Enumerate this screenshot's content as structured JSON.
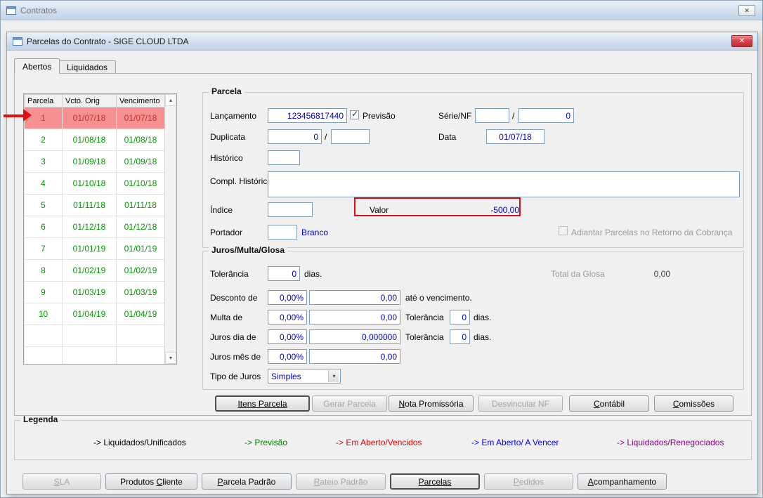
{
  "icons": {
    "close": "✕",
    "scroll_up": "▴",
    "scroll_down": "▾",
    "dropdown": "▾",
    "check": "✓"
  },
  "outer_window": {
    "title": "Contratos"
  },
  "dialog": {
    "title": "Parcelas do Contrato - SIGE CLOUD LTDA"
  },
  "tabs": {
    "abertos": "Abertos",
    "liquidados": "Liquidados"
  },
  "grid": {
    "headers": [
      "Parcela",
      "Vcto. Orig",
      "Vencimento"
    ],
    "rows": [
      {
        "parcela": "1",
        "vcto_orig": "01/07/18",
        "vencimento": "01/07/18",
        "state": "selected"
      },
      {
        "parcela": "2",
        "vcto_orig": "01/08/18",
        "vencimento": "01/08/18",
        "state": "previsao"
      },
      {
        "parcela": "3",
        "vcto_orig": "01/09/18",
        "vencimento": "01/09/18",
        "state": "previsao"
      },
      {
        "parcela": "4",
        "vcto_orig": "01/10/18",
        "vencimento": "01/10/18",
        "state": "previsao"
      },
      {
        "parcela": "5",
        "vcto_orig": "01/11/18",
        "vencimento": "01/11/18",
        "state": "previsao"
      },
      {
        "parcela": "6",
        "vcto_orig": "01/12/18",
        "vencimento": "01/12/18",
        "state": "previsao"
      },
      {
        "parcela": "7",
        "vcto_orig": "01/01/19",
        "vencimento": "01/01/19",
        "state": "previsao"
      },
      {
        "parcela": "8",
        "vcto_orig": "01/02/19",
        "vencimento": "01/02/19",
        "state": "previsao"
      },
      {
        "parcela": "9",
        "vcto_orig": "01/03/19",
        "vencimento": "01/03/19",
        "state": "previsao"
      },
      {
        "parcela": "10",
        "vcto_orig": "01/04/19",
        "vencimento": "01/04/19",
        "state": "previsao"
      }
    ],
    "empty_rows": 2
  },
  "parcela_box": {
    "title": "Parcela",
    "lancamento_label": "Lançamento",
    "lancamento_value": "123456817440",
    "previsao_label": "Previsão",
    "previsao_checked": true,
    "serie_nf_label": "Série/NF",
    "serie_value": "",
    "serie_sep": "/",
    "nf_value": "0",
    "duplicata_label": "Duplicata",
    "duplicata_value": "0",
    "duplicata_sep": "/",
    "duplicata_value2": "",
    "data_label": "Data",
    "data_value": "01/07/18",
    "historico_label": "Histórico",
    "historico_value": "",
    "compl_historico_label": "Compl. Histórico",
    "compl_historico_value": "",
    "indice_label": "Índice",
    "indice_value": "",
    "valor_label": "Valor",
    "valor_value": "-500,00",
    "portador_label": "Portador",
    "portador_value": "",
    "portador_desc": "Branco",
    "adiantar_label": "Adiantar Parcelas no Retorno da Cobrança"
  },
  "juros_box": {
    "title": "Juros/Multa/Glosa",
    "tolerancia_label": "Tolerância",
    "tolerancia_value": "0",
    "tolerancia_dias_label": "dias.",
    "total_glosa_label": "Total da Glosa",
    "total_glosa_value": "0,00",
    "desconto_label": "Desconto de",
    "desconto_pct": "0,00%",
    "desconto_value": "0,00",
    "ate_vencimento_label": "até o vencimento.",
    "multa_label": "Multa de",
    "multa_pct": "0,00%",
    "multa_value": "0,00",
    "multa_tolerancia_label": "Tolerância",
    "multa_tolerancia_value": "0",
    "multa_dias_label": "dias.",
    "juros_dia_label": "Juros dia de",
    "juros_dia_pct": "0,00%",
    "juros_dia_value": "0,000000",
    "juros_dia_tolerancia_label": "Tolerância",
    "juros_dia_tolerancia_value": "0",
    "juros_dia_dias_label": "dias.",
    "juros_mes_label": "Juros mês de",
    "juros_mes_pct": "0,00%",
    "juros_mes_value": "0,00",
    "tipo_juros_label": "Tipo de Juros",
    "tipo_juros_value": "Simples"
  },
  "action_buttons": [
    {
      "name": "itens-parcela-button",
      "label": "Itens Parcela",
      "ul": "Itens Parcela",
      "enabled": true,
      "default": true
    },
    {
      "name": "gerar-parcela-button",
      "label": "Gerar Parcela",
      "ul": "",
      "enabled": false,
      "default": false
    },
    {
      "name": "nota-promissoria-button",
      "label": "Nota Promissória",
      "ul": "N",
      "enabled": true,
      "default": false
    },
    {
      "name": "desvincular-nf-button",
      "label": "Desvincular NF",
      "ul": "",
      "enabled": false,
      "default": false
    },
    {
      "name": "contabil-button",
      "label": "Contábil",
      "ul": "C",
      "enabled": true,
      "default": false
    },
    {
      "name": "comissoes-button",
      "label": "Comissões",
      "ul": "C",
      "enabled": true,
      "default": false
    }
  ],
  "legend": {
    "title": "Legenda",
    "items": [
      {
        "text": "-> Liquidados/Unificados",
        "color": "#000000"
      },
      {
        "text": "-> Previsão",
        "color": "#008000"
      },
      {
        "text": "-> Em Aberto/Vencidos",
        "color": "#e00000"
      },
      {
        "text": "-> Em Aberto/ A Vencer",
        "color": "#0000ff"
      },
      {
        "text": "-> Liquidados/Renegociados",
        "color": "#800080"
      }
    ]
  },
  "bottom_buttons": [
    {
      "name": "sla-button",
      "label": "SLA",
      "ul": "S",
      "enabled": false,
      "default": false
    },
    {
      "name": "produtos-cliente-button",
      "label": "Produtos Cliente",
      "ul": "C",
      "enabled": true,
      "default": false
    },
    {
      "name": "parcela-padrao-button",
      "label": "Parcela Padrão",
      "ul": "P",
      "enabled": true,
      "default": false
    },
    {
      "name": "rateio-padrao-button",
      "label": "Rateio Padrão",
      "ul": "R",
      "enabled": false,
      "default": false
    },
    {
      "name": "parcelas-button",
      "label": "Parcelas",
      "ul": "Parcelas",
      "enabled": true,
      "default": true
    },
    {
      "name": "pedidos-button",
      "label": "Pedidos",
      "ul": "P",
      "enabled": false,
      "default": false
    },
    {
      "name": "acompanhamento-button",
      "label": "Acompanhamento",
      "ul": "A",
      "enabled": true,
      "default": false
    }
  ],
  "colors": {
    "selected_row_bg": "#f79090",
    "selected_row_text": "#c03333",
    "previsao_row_text": "#009900",
    "value_text": "#0000cc",
    "annotation": "#dd1111"
  }
}
